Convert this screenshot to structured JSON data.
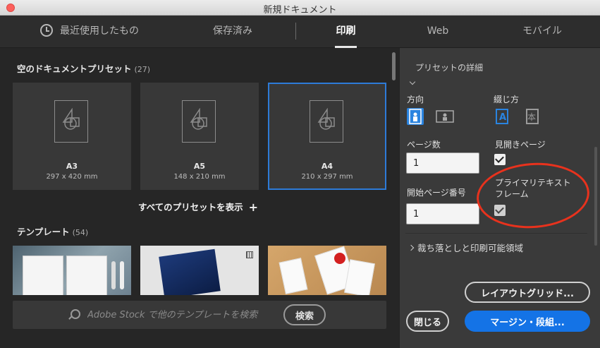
{
  "window": {
    "title": "新規ドキュメント"
  },
  "tabs": [
    {
      "label": "最近使用したもの",
      "icon": "clock-icon"
    },
    {
      "label": "保存済み"
    },
    {
      "label": "印刷",
      "active": true
    },
    {
      "label": "Web"
    },
    {
      "label": "モバイル"
    }
  ],
  "presets": {
    "title": "空のドキュメントプリセット",
    "count": "(27)",
    "items": [
      {
        "name": "A3",
        "size": "297 x 420 mm"
      },
      {
        "name": "A5",
        "size": "148 x 210 mm"
      },
      {
        "name": "A4",
        "size": "210 x 297 mm",
        "selected": true
      }
    ],
    "show_all": "すべてのプリセットを表示"
  },
  "templates": {
    "title": "テンプレート",
    "count": "(54)"
  },
  "search": {
    "placeholder": "Adobe Stock で他のテンプレートを検索",
    "button": "検索"
  },
  "details": {
    "title": "プリセットの詳細",
    "orientation_label": "方向",
    "binding_label": "綴じ方",
    "pages_label": "ページ数",
    "pages_value": "1",
    "facing_label": "見開きページ",
    "facing_checked": true,
    "start_label": "開始ページ番号",
    "start_value": "1",
    "primary_frame_label_line1": "プライマリテキスト",
    "primary_frame_label_line2": "フレーム",
    "primary_frame_checked": true,
    "bleed_label": "裁ち落としと印刷可能領域",
    "binding_right_glyph": "本",
    "binding_left_glyph": "A"
  },
  "buttons": {
    "layout_grid": "レイアウトグリッド...",
    "close": "閉じる",
    "margins": "マージン・段組..."
  },
  "colors": {
    "accent": "#1473e6",
    "selection": "#2d7bd8",
    "annotation": "#e8321d"
  }
}
